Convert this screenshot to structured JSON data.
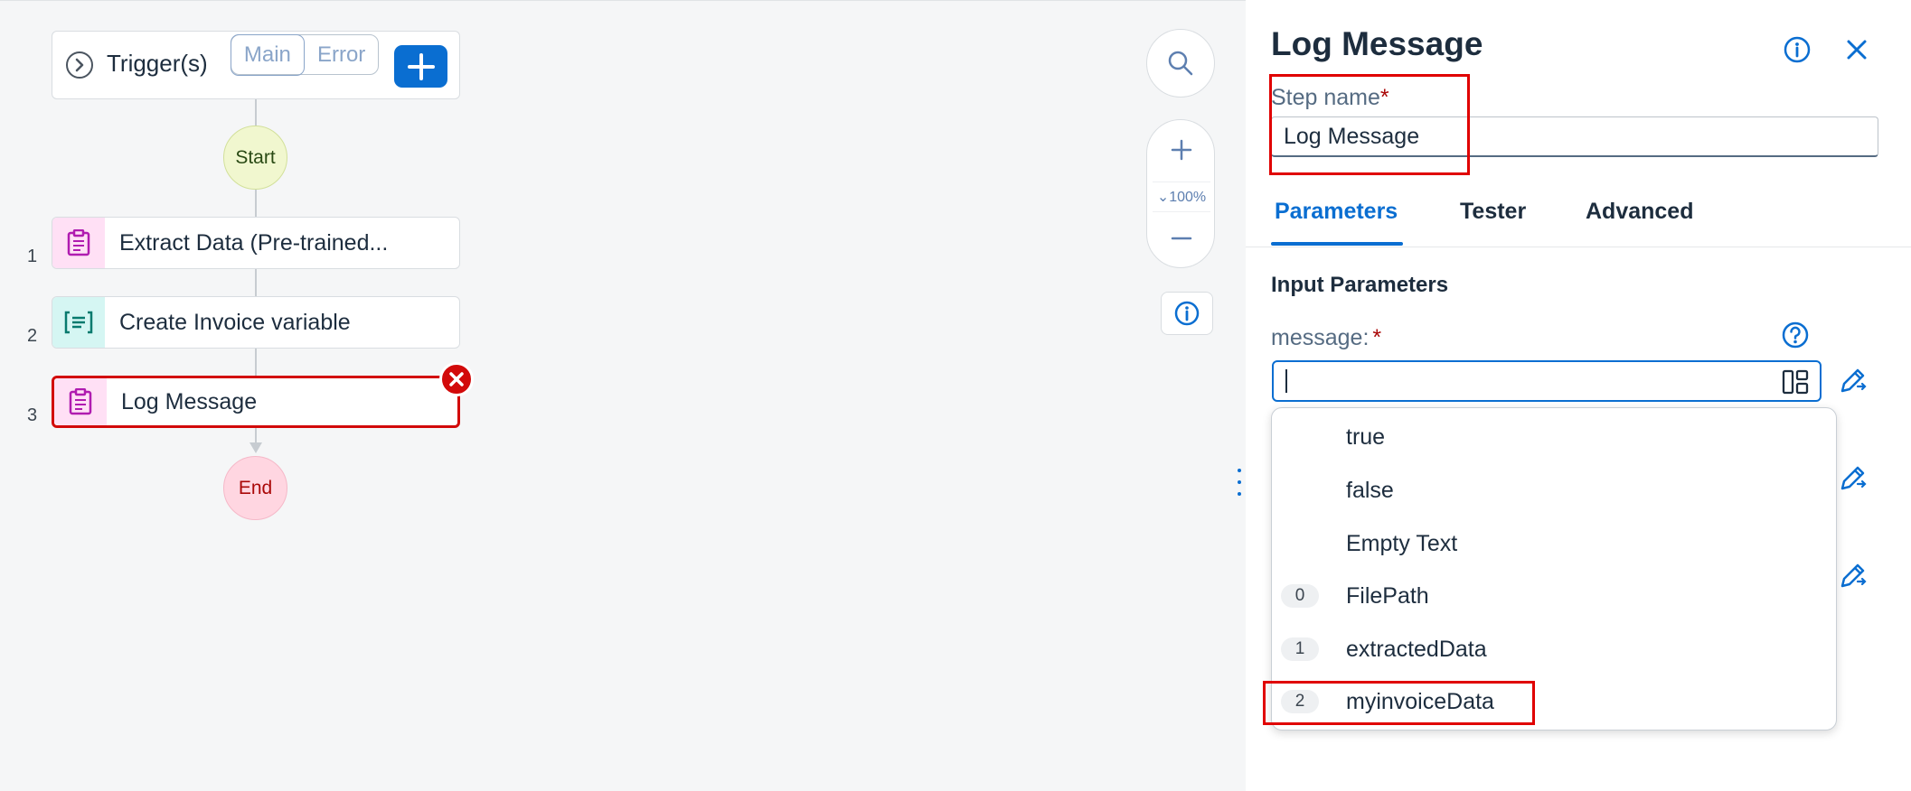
{
  "canvas": {
    "trigger": {
      "label": "Trigger(s)",
      "segments": [
        "Main",
        "Error"
      ]
    },
    "start_label": "Start",
    "end_label": "End",
    "steps": [
      {
        "number": "1",
        "label": "Extract Data (Pre-trained...",
        "icon": "clipboard-icon"
      },
      {
        "number": "2",
        "label": "Create Invoice variable",
        "icon": "list-variable-icon"
      },
      {
        "number": "3",
        "label": "Log Message",
        "icon": "clipboard-icon"
      }
    ],
    "zoom": {
      "level": "100%"
    }
  },
  "panel": {
    "title": "Log Message",
    "step_name_label": "Step name",
    "required_marker": "*",
    "step_name_value": "Log Message",
    "tabs": [
      "Parameters",
      "Tester",
      "Advanced"
    ],
    "section_title": "Input Parameters",
    "message_label": "message:",
    "message_value": "",
    "dropdown": [
      {
        "num": "",
        "text": "true"
      },
      {
        "num": "",
        "text": "false"
      },
      {
        "num": "",
        "text": "Empty Text"
      },
      {
        "num": "0",
        "text": "FilePath"
      },
      {
        "num": "1",
        "text": "extractedData"
      },
      {
        "num": "2",
        "text": "myinvoiceData"
      }
    ]
  },
  "colors": {
    "accent": "#0a6ed1",
    "error": "#d20a0a",
    "highlight": "#e00000"
  }
}
